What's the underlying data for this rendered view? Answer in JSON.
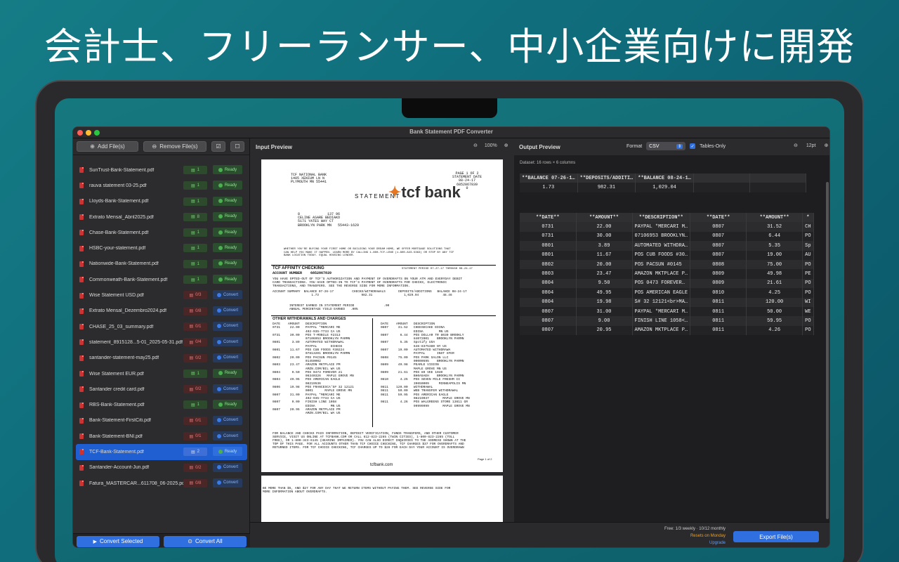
{
  "headline": "会計士、フリーランサー、中小企業向けに開発",
  "window": {
    "title": "Bank Statement PDF Converter"
  },
  "toolbar": {
    "add": "Add File(s)",
    "remove": "Remove File(s)"
  },
  "files": [
    {
      "name": "SunTrust-Bank-Statement.pdf",
      "pages": "1",
      "status": "Ready"
    },
    {
      "name": "rauva statement 03-25.pdf",
      "pages": "1",
      "status": "Ready"
    },
    {
      "name": "Lloyds-Bank-Statement.pdf",
      "pages": "1",
      "status": "Ready"
    },
    {
      "name": "Extrato Mensal_Abril2025.pdf",
      "pages": "8",
      "status": "Ready"
    },
    {
      "name": "Chase-Bank-Statement.pdf",
      "pages": "1",
      "status": "Ready"
    },
    {
      "name": "HSBC-your-statement.pdf",
      "pages": "1",
      "status": "Ready"
    },
    {
      "name": "Nationwide-Bank-Statement.pdf",
      "pages": "1",
      "status": "Ready"
    },
    {
      "name": "Commonweath-Bank-Statement.pdf",
      "pages": "1",
      "status": "Ready"
    },
    {
      "name": "Wise Statement USD.pdf",
      "pages": "0/3",
      "status": "Convert"
    },
    {
      "name": "Extrato Mensal_Dezembro2024.pdf",
      "pages": "0/8",
      "status": "Convert"
    },
    {
      "name": "CHASE_25_03_summary.pdf",
      "pages": "0/1",
      "status": "Convert"
    },
    {
      "name": "statement_8915128...5-01_2025-05-31.pdf",
      "pages": "0/4",
      "status": "Convert"
    },
    {
      "name": "santander-statement-may25.pdf",
      "pages": "0/2",
      "status": "Convert"
    },
    {
      "name": "Wise Statement EUR.pdf",
      "pages": "1",
      "status": "Ready"
    },
    {
      "name": "Santander credit card.pdf",
      "pages": "0/2",
      "status": "Convert"
    },
    {
      "name": "RBS-Bank-Statement.pdf",
      "pages": "1",
      "status": "Ready"
    },
    {
      "name": "Bank-Statement-FirstCiti.pdf",
      "pages": "0/1",
      "status": "Convert"
    },
    {
      "name": "Bank-Statement-BNI.pdf",
      "pages": "0/1",
      "status": "Convert"
    },
    {
      "name": "TCF-Bank-Statement.pdf",
      "pages": "2",
      "status": "Ready",
      "selected": true
    },
    {
      "name": "Santander-Account-Jun.pdf",
      "pages": "0/2",
      "status": "Convert"
    },
    {
      "name": "Fatura_MASTERCAR...611708_06-2025.pdf",
      "pages": "0/8",
      "status": "Convert"
    }
  ],
  "sidebar_bottom": {
    "convert_selected": "Convert Selected",
    "convert_all": "Convert All"
  },
  "input": {
    "title": "Input Preview",
    "zoom": "100%"
  },
  "doc": {
    "bank_addr": "TCF NATIONAL BANK\n1405 XENIUM LN N\nPLYMOUTH MN 55441",
    "logo": "tcf bank",
    "statement_word": "STATEMENT",
    "page_info": "PAGE 1 OF 2\nSTATEMENT DATE\n08-24-17\n6852867839\n0",
    "customer": "8             137 96\nCELINE ASARE BEDIAKO\n5171 YATES WAY CT\nBROOKLYN PARK MN   55443-1629",
    "promo": "WHETHER YOU'RE BUYING YOUR FIRST HOME OR BUILDING YOUR DREAM HOME, WE OFFER MORTGAGE SOLUTIONS THAT\nCAN HELP YOU MAKE IT HAPPEN. LEARN MORE BY CALLING 1-800-TCF-LEND (1-800-823-5363) OR STOP BY ANY TCF\nBANK LOCATION TODAY. EQUAL HOUSING LENDER.",
    "checking": "TCF AFFINITY CHECKING",
    "acct": "ACCOUNT NUMBER    6852867839",
    "period": "STATEMENT PERIOD 07-27-17 THROUGH 08-24-17",
    "optin": "YOU HAVE OPTED-OUT OF TCF'S AUTHORIZATION AND PAYMENT OF OVERDRAFTS ON YOUR ATM AND EVERYDAY DEBIT\nCARD TRANSACTIONS. YOU HAVE OPTED-IN TO TCF'S PAYMENT OF OVERDRAFTS FOR CHECKS, ELECTRONIC\nTRANSACTIONS, AND TRANSFERS. SEE THE REVERSE SIDE FOR MORE INFORMATION.",
    "summary": "ACCOUNT SUMMARY  BALANCE 07-26-17          CHECKS/WITHDRAWALS       DEPOSITS/ADDITIONS   BALANCE 08-24-17\n                     1.73                       982.31                 1,029.04             48.46",
    "interest": "INTEREST EARNED IN STATEMENT PERIOD                .00\nANNUAL PERCENTAGE YIELD EARNED   .00%",
    "wd_title": "OTHER WITHDRAWALS AND CHARGES",
    "wd_left": "DATE    AMOUNT   DESCRIPTION\n0731     22.00   PAYPAL *MERCARI ME\n                 402-935-7733 CA US\n0731     30.00   POS T-MOBILE #2313\n                 07106953 BROOKLYN PARMN\n0801      3.89   AUTOMATED WITHDRAWAL\n                 PAYPAL       ECHECK\n0801     11.67   POS CUB FOODS #30224\n                 07813201 BROOKLYN PARMN\n0802     20.00   POS PACSUN #0145\n                 01450002\n0803     23.47   AMAZON MKTPLACE PM\n                 AMZN.COM/BIL WA US\n0804      9.50   POS 0473 FOREVER 21\n                 06340326   MAPLE GROVE MN\n0804     49.95   POS AMERICAN EAGLE\n                 08219536\n0806     19.98   POS FRANCESCA'S# 32 12121\n                 0001      MAPLE GROVE MN\n0807     31.00   PAYPAL *MERCARI ME\n                 402-935-7733 CA US\n0807      9.00   FINISH LINE 1058\n                 EDINA        MN US\n0807     20.95   AMAZON MKTPLACE PM\n                 AMZN.COM/BIL WA US",
    "wd_right": "DATE    AMOUNT   DESCRIPTION\n0807     31.52   CHEESECAKE EDINA\n                 EDINA        MN US\n0807      6.44   POS DOLLAR TR 8030 BROOKLY\n                 84072001    BROOKLYN PARMN\n0807      5.35   Spotify USA\n                 646-8375380 NY US\n0807     19.00   AUTOMATED WITHDRAWA\n                 PAYPAL      INST XFER\n0808     75.00   POS PARK SALON LLC\n                 00000595    BROOKLYN PARMN\n0809     49.98   PEARLE VISION\n                 MAPLE GROVE MN US\n0809     21.61   POS 89 VEE 1040\n                 BH0A5AEH    BROOKLYN PARMN\n0810      4.25   POS SEVEN MILE FRESHM II\n                 39650009     MINNEAPOLIS MN\n0811    120.00   WITHDRAWAL\n0811     50.00   WEB TRANSFER WITHDRAWAL\n0811     59.95   POS AMERICAN EAGLE\n                 08219037       MAPLE GROVE MN\n0811      4.26   POS WALGREENS STORE 13611 GR\n                 99999999       MAPLE GROVE MN",
    "disclaimer": "FOR BALANCE AND CHECKS PAID INFORMATION, DEPOSIT VERIFICATION, FUNDS TRANSFERS, AND OTHER CUSTOMER\nSERVICE, VISIT US ONLINE AT TCFBANK.COM OR CALL 612-823-2265 (TWIN CITIES), 1-800-823-2265 (TOLL\nFREE), OR 1-800-343-6145 (HEARING IMPAIRED). YOU CAN ALSO DIRECT INQUIRIES TO THE ADDRESS SHOWN AT THE\nTOP OF THIS PAGE. FOR ALL ACCOUNTS OTHER THAN TCF CHOICE CHECKING, TCF CHARGES $37 FOR OVERDRAFTS AND\nRETURNED ITEMS. FOR TCF CHOICE CHECKING, TCF CHARGES UP TO $28 FOR EACH DAY YOUR ACCOUNT IS OVERDRAWN",
    "page_of": "Page 1 of 2",
    "site": "tcfbank.com",
    "page2": "BE MORE THAN $5, AND $27 FOR ANY DAY THAT WE RETURN ITEMS WITHOUT PAYING THEM. SEE REVERSE SIDE FOR\nMORE INFORMATION ABOUT OVERDRAFTS."
  },
  "output": {
    "title": "Output Preview",
    "format_label": "Format",
    "format_value": "CSV",
    "tables_only": "Tables-Only",
    "font_size": "12pt",
    "dataset": "Dataset: 16 rows × 6 columns"
  },
  "summary_table": {
    "headers": [
      "**BALANCE 07-26-1…",
      "**DEPOSITS/ADDITI…",
      "**BALANCE 08-24-1…"
    ],
    "row": [
      "1.73",
      "982.31",
      "1,029.04"
    ]
  },
  "main_table": {
    "headers": [
      "**DATE**",
      "**AMOUNT**",
      "**DESCRIPTION**",
      "**DATE**",
      "**AMOUNT**",
      "*"
    ],
    "rows": [
      [
        "0731",
        "22.00",
        "PAYPAL *MERCARI M…",
        "0807",
        "31.52",
        "CH"
      ],
      [
        "0731",
        "30.00",
        "07106953 BROOKLYN…",
        "0807",
        "6.44",
        "PO"
      ],
      [
        "0801",
        "3.89",
        "AUTOMATED WITHDRA…",
        "0807",
        "5.35",
        "Sp"
      ],
      [
        "0801",
        "11.67",
        "POS CUB FOODS #30…",
        "0807",
        "19.00",
        "AU"
      ],
      [
        "0802",
        "20.00",
        "POS PACSUN #0145",
        "0808",
        "75.00",
        "PO"
      ],
      [
        "0803",
        "23.47",
        "AMAZON MKTPLACE P…",
        "0809",
        "49.98",
        "PE"
      ],
      [
        "0804",
        "9.50",
        "POS 0473 FOREVER…",
        "0809",
        "21.61",
        "PO"
      ],
      [
        "0804",
        "49.95",
        "POS AMERICAN EAGLE",
        "0810",
        "4.25",
        "PO"
      ],
      [
        "0804",
        "19.98",
        "S# 32 12121<br>MA…",
        "0811",
        "120.00",
        "WI"
      ],
      [
        "0807",
        "31.00",
        "PAYPAL *MERCARI M…",
        "0811",
        "50.00",
        "WE"
      ],
      [
        "0807",
        "9.00",
        "FINISH LINE 1058<…",
        "0811",
        "59.95",
        "PO"
      ],
      [
        "0807",
        "20.95",
        "AMAZON MKTPLACE P…",
        "0811",
        "4.26",
        "PO"
      ]
    ]
  },
  "footer": {
    "free": "Free: 1/3 weekly · 10/12 monthly",
    "resets": "Resets on Monday",
    "upgrade": "Upgrade",
    "export": "Export File(s)"
  },
  "colors": {
    "accent": "#2f6fe0",
    "ready": "#4caf50",
    "convert": "#3b7be8",
    "resets": "#f0a020"
  }
}
